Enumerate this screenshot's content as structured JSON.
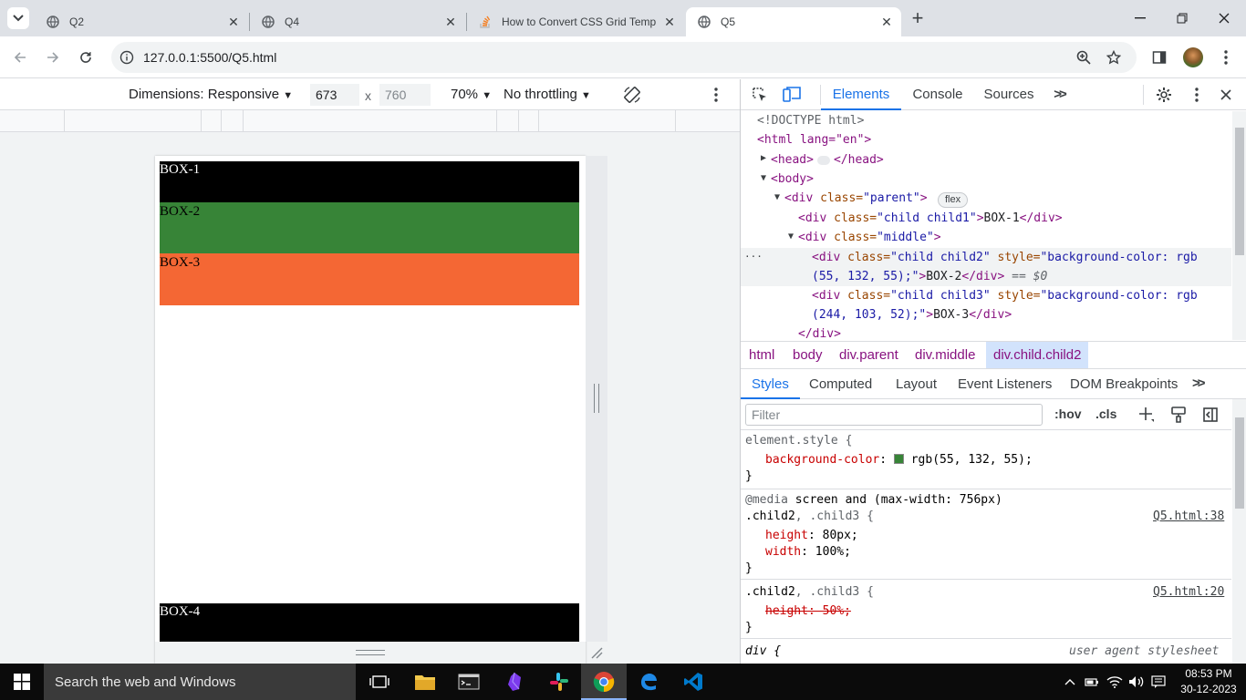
{
  "tabs": [
    {
      "label": "Q2",
      "close": "✕"
    },
    {
      "label": "Q4",
      "close": "✕"
    },
    {
      "label": "How to Convert CSS Grid Temp",
      "close": "✕"
    },
    {
      "label": "Q5",
      "close": "✕"
    }
  ],
  "new_tab": "+",
  "address": {
    "url": "127.0.0.1:5500/Q5.html"
  },
  "device_toolbar": {
    "dimensions_label": "Dimensions: Responsive",
    "width": "673",
    "times": "x",
    "height_placeholder": "760",
    "zoom": "70%",
    "throttling": "No throttling"
  },
  "page": {
    "boxes": [
      {
        "label": "BOX-1",
        "color": "#000000",
        "text_color": "#ffffff"
      },
      {
        "label": "BOX-2",
        "color": "#378437",
        "text_color": "#000000"
      },
      {
        "label": "BOX-3",
        "color": "#f46734",
        "text_color": "#000000"
      },
      {
        "label": "BOX-4",
        "color": "#000000",
        "text_color": "#ffffff"
      }
    ]
  },
  "devtools": {
    "tabs": [
      "Elements",
      "Console",
      "Sources"
    ],
    "more": ">>",
    "dom": {
      "doctype": "<!DOCTYPE html>",
      "html_open": "<html lang=\"en\">",
      "head": "<head>",
      "head_close": "</head>",
      "body": "<body>",
      "parent_open_tag": "<div ",
      "parent_attr": "class=",
      "parent_val": "\"parent\"",
      "flex_badge": "flex",
      "child1_val": "\"child child1\"",
      "child1_text": "BOX-1",
      "middle_val": "\"middle\"",
      "child2_val": "\"child child2\"",
      "style_attr": "style=",
      "child2_style": "\"background-color: rgb",
      "child2_style2": "(55, 132, 55);\"",
      "child2_text": "BOX-2",
      "selected_marker": "== $0",
      "child3_val": "\"child child3\"",
      "child3_style": "\"background-color: rgb",
      "child3_style2": "(244, 103, 52);\"",
      "child3_text": "BOX-3",
      "div_close": "</div>",
      "ellipsis": "..."
    },
    "breadcrumbs": [
      "html",
      "body",
      "div.parent",
      "div.middle",
      "div.child.child2"
    ],
    "subtabs": [
      "Styles",
      "Computed",
      "Layout",
      "Event Listeners",
      "DOM Breakpoints"
    ],
    "filter_placeholder": "Filter",
    "hov": ":hov",
    "cls": ".cls",
    "styles": {
      "element_style": "element.style {",
      "bg_prop": "background-color",
      "bg_val": "rgb(55, 132, 55);",
      "swatch": "#378437",
      "close_brace": "}",
      "media_kw": "@media",
      "media_query": "screen and (max-width: 756px)",
      "rule1_selector_a": ".child2",
      "rule1_selector_b": ", .child3 {",
      "rule1_src": "Q5.html:38",
      "height_prop": "height",
      "height_val": "80px;",
      "width_prop": "width",
      "width_val": "100%;",
      "rule2_src": "Q5.html:20",
      "height_struck": "height: 50%;",
      "div_rule": "div {",
      "user_agent": "user agent stylesheet"
    }
  },
  "taskbar": {
    "search_placeholder": "Search the web and Windows",
    "time": "08:53 PM",
    "date": "30-12-2023"
  }
}
